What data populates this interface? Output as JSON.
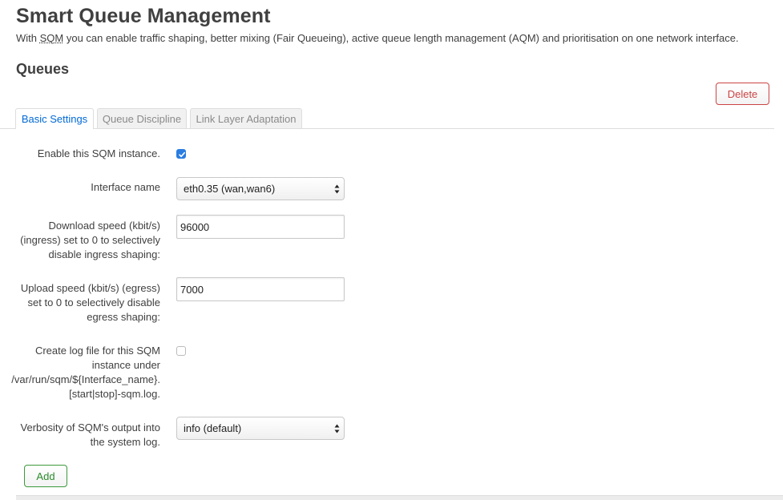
{
  "page": {
    "title": "Smart Queue Management",
    "description_pre": "With ",
    "description_abbr": "SQM",
    "description_post": " you can enable traffic shaping, better mixing (Fair Queueing), active queue length management (AQM) and prioritisation on one network interface."
  },
  "section": {
    "title": "Queues",
    "delete_label": "Delete",
    "add_label": "Add"
  },
  "tabs": [
    {
      "label": "Basic Settings",
      "active": true
    },
    {
      "label": "Queue Discipline",
      "active": false
    },
    {
      "label": "Link Layer Adaptation",
      "active": false
    }
  ],
  "form": {
    "enable": {
      "label": "Enable this SQM instance.",
      "checked": true
    },
    "interface": {
      "label": "Interface name",
      "value": "eth0.35 (wan,wan6)"
    },
    "download": {
      "label_lines": [
        "Download speed (kbit/s)",
        "(ingress) set to 0 to selectively",
        "disable ingress shaping:"
      ],
      "value": "96000"
    },
    "upload": {
      "label_lines": [
        "Upload speed (kbit/s) (egress)",
        "set to 0 to selectively disable",
        "egress shaping:"
      ],
      "value": "7000"
    },
    "log": {
      "label_lines": [
        "Create log file for this SQM",
        "instance under",
        "/var/run/sqm/${Interface_name}.",
        "[start|stop]-sqm.log."
      ],
      "checked": false
    },
    "verbosity": {
      "label_lines": [
        "Verbosity of SQM's output into",
        "the system log."
      ],
      "value": "info (default)"
    }
  },
  "colors": {
    "accent": "#0069d6",
    "delete": "#cc4444",
    "add": "#2b8a2b",
    "checkbox": "#2a7de1"
  }
}
